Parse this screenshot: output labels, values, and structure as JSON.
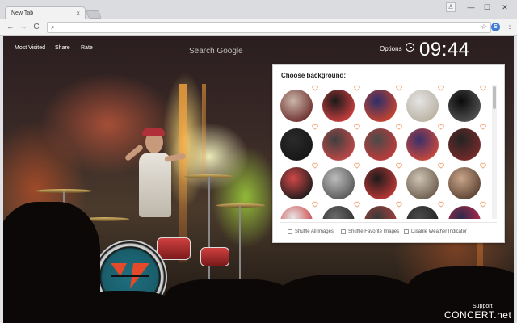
{
  "browser": {
    "tab_title": "New Tab",
    "tab_close": "×",
    "window_controls": {
      "minimize": "—",
      "maximize": "☐",
      "close": "✕"
    },
    "nav": {
      "back": "←",
      "forward": "→",
      "reload": "C"
    },
    "omnibox": {
      "value": "",
      "placeholder": ""
    },
    "extension_badge": "S"
  },
  "page": {
    "nav_links": [
      "Most Visited",
      "Share",
      "Rate"
    ],
    "search": {
      "placeholder": "Search Google"
    },
    "options_label": "Options",
    "time": "09:44",
    "support_label": "Support",
    "watermark": "CONCERT.net"
  },
  "panel": {
    "title": "Choose background:",
    "thumbnails": [
      {
        "name": "thumb-1",
        "colors": [
          "#c9b6a8",
          "#6b2b2b"
        ]
      },
      {
        "name": "thumb-2",
        "colors": [
          "#1a1a1a",
          "#d04040"
        ]
      },
      {
        "name": "thumb-3",
        "colors": [
          "#2b2f6b",
          "#d0452b"
        ]
      },
      {
        "name": "thumb-4",
        "colors": [
          "#e4e4e4",
          "#b8b0a0"
        ]
      },
      {
        "name": "thumb-5",
        "colors": [
          "#0a0a0a",
          "#555555"
        ]
      },
      {
        "name": "thumb-6",
        "colors": [
          "#2a2a2a",
          "#161616"
        ]
      },
      {
        "name": "thumb-7",
        "colors": [
          "#3f3f3f",
          "#c44848"
        ]
      },
      {
        "name": "thumb-8",
        "colors": [
          "#4a4a4a",
          "#c43a3a"
        ]
      },
      {
        "name": "thumb-9",
        "colors": [
          "#3a2f6a",
          "#d04a3a"
        ]
      },
      {
        "name": "thumb-10",
        "colors": [
          "#242424",
          "#7a2a2a"
        ]
      },
      {
        "name": "thumb-11",
        "colors": [
          "#d04848",
          "#1a1a1a"
        ]
      },
      {
        "name": "thumb-12",
        "colors": [
          "#bdbdbd",
          "#555555"
        ]
      },
      {
        "name": "thumb-13",
        "colors": [
          "#1b1b1b",
          "#c43838"
        ]
      },
      {
        "name": "thumb-14",
        "colors": [
          "#cfc4b4",
          "#6a5a4a"
        ]
      },
      {
        "name": "thumb-15",
        "colors": [
          "#c9a58a",
          "#5a4030"
        ]
      },
      {
        "name": "thumb-16",
        "colors": [
          "#e6e6e6",
          "#cc3a3a"
        ]
      },
      {
        "name": "thumb-17",
        "colors": [
          "#6a6a6a",
          "#2a2a2a"
        ]
      },
      {
        "name": "thumb-18",
        "colors": [
          "#3a3a3a",
          "#b0403a"
        ]
      },
      {
        "name": "thumb-19",
        "colors": [
          "#4a4a4a",
          "#202020"
        ]
      },
      {
        "name": "thumb-20",
        "colors": [
          "#2a2a4a",
          "#c02a4a"
        ]
      }
    ],
    "options": [
      "Shuffle All Images",
      "Shuffle Favorite Images",
      "Disable Weather Indicator"
    ]
  },
  "colors": {
    "heart": "#f0a070",
    "panel_bg": "#ffffff"
  },
  "icons": [
    "back-icon",
    "forward-icon",
    "reload-icon",
    "star-icon",
    "clock-icon",
    "heart-icon",
    "menu-icon"
  ]
}
